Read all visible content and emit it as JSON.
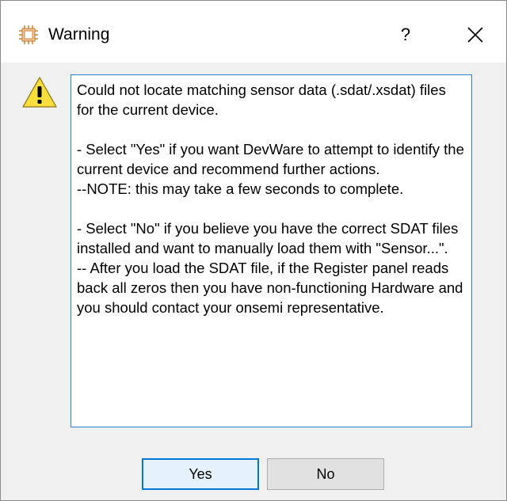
{
  "window": {
    "title": "Warning",
    "help_label": "?",
    "app_icon": "chip-icon",
    "close_icon": "close-icon"
  },
  "message": {
    "icon": "warning-icon",
    "text": "Could not locate matching sensor data (.sdat/.xsdat) files for the current device.\n\n- Select \"Yes\" if you want DevWare to attempt to identify the current device and recommend further actions.\n--NOTE: this may take a few seconds to complete.\n\n- Select \"No\" if you believe you have the correct SDAT files installed and want to manually load them with \"Sensor...\".\n-- After you load the SDAT file, if the Register panel reads back all zeros then you have non-functioning Hardware and you should contact your onsemi representative."
  },
  "buttons": {
    "yes_label": "Yes",
    "no_label": "No"
  },
  "colors": {
    "focus_blue": "#0078d7",
    "warning_yellow": "#f9de3c",
    "text_border_blue": "#2d82d6"
  }
}
